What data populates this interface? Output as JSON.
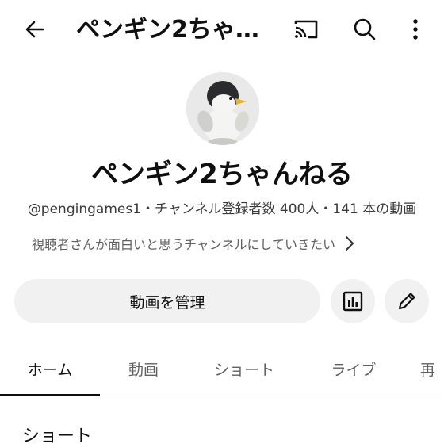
{
  "topbar": {
    "title": "ペンギン2ちゃ…",
    "icons": [
      "back-arrow-icon",
      "cast-icon",
      "search-icon",
      "more-vertical-icon"
    ]
  },
  "channel": {
    "name": "ペンギン2ちゃんねる",
    "meta": "@pengingames1・チャンネル登録者数 400人・141 本の動画",
    "description": "視聴者さんが面白いと思うチャンネルにしていきたい"
  },
  "actions": {
    "manage_videos": "動画を管理",
    "icons": [
      "analytics-icon",
      "edit-pencil-icon"
    ]
  },
  "tabs": [
    {
      "label": "ホーム",
      "active": true
    },
    {
      "label": "動画",
      "active": false
    },
    {
      "label": "ショート",
      "active": false
    },
    {
      "label": "ライブ",
      "active": false
    },
    {
      "label": "再",
      "active": false
    }
  ],
  "section": {
    "title": "ショート"
  },
  "colors": {
    "text_primary": "#0f0f0f",
    "text_secondary": "#606060",
    "button_bg": "#f1f1f1"
  }
}
